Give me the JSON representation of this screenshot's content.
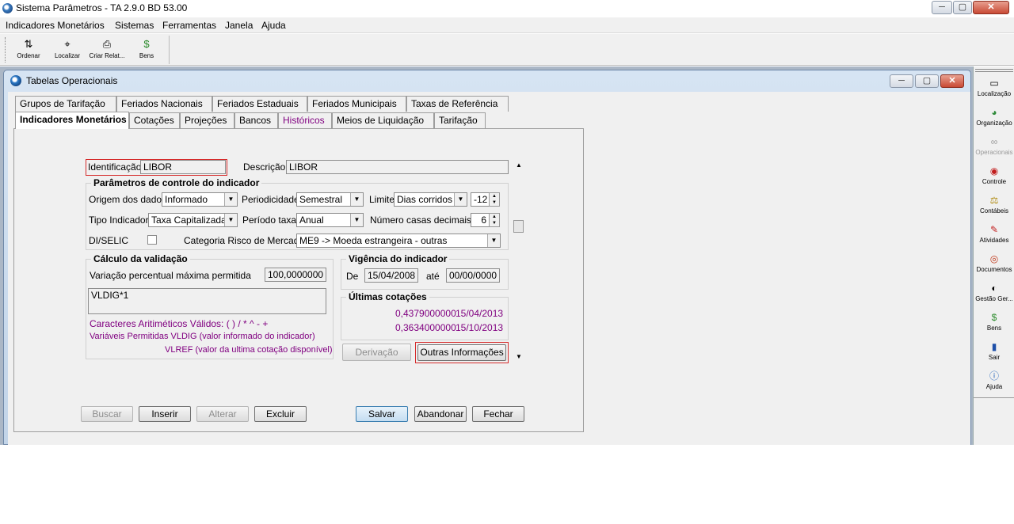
{
  "app": {
    "title": "Sistema Parâmetros -  TA 2.9.0 BD 53.00"
  },
  "window_controls": {
    "minimize": "─",
    "maximize": "▢",
    "close": "✕"
  },
  "menu": [
    "Indicadores Monetários",
    "Sistemas",
    "Ferramentas",
    "Janela",
    "Ajuda"
  ],
  "toolbar": [
    {
      "label": "Ordenar",
      "icon": "sort-icon"
    },
    {
      "label": "Localizar",
      "icon": "locate-icon"
    },
    {
      "label": "Criar Relat...",
      "icon": "printer-icon"
    },
    {
      "label": "Bens",
      "icon": "money-bag-icon"
    }
  ],
  "right_panel": [
    {
      "label": "Localização",
      "icon": "locate-icon"
    },
    {
      "label": "Organização",
      "icon": "organization-icon"
    },
    {
      "label": "Operacionais",
      "icon": "handshake-icon"
    },
    {
      "label": "Controle",
      "icon": "control-icon"
    },
    {
      "label": "Contábeis",
      "icon": "scale-icon"
    },
    {
      "label": "Atividades",
      "icon": "pen-icon"
    },
    {
      "label": "Documentos",
      "icon": "target-icon"
    },
    {
      "label": "Gestão Ger...",
      "icon": "eye-icon"
    },
    {
      "label": "Bens",
      "icon": "money-bag-icon"
    },
    {
      "label": "Sair",
      "icon": "exit-door-icon"
    },
    {
      "label": "Ajuda",
      "icon": "help-icon"
    }
  ],
  "child_window": {
    "title": "Tabelas Operacionais"
  },
  "tabs_row1": [
    "Grupos de Tarifação",
    "Feriados Nacionais",
    "Feriados Estaduais",
    "Feriados Municipais",
    "Taxas de Referência"
  ],
  "tabs_row2": [
    "Indicadores Monetários",
    "Cotações",
    "Projeções",
    "Bancos",
    "Históricos",
    "Meios de Liquidação",
    "Tarifação"
  ],
  "form": {
    "identificacao_label": "Identificação",
    "identificacao_value": "LIBOR",
    "descricao_label": "Descrição",
    "descricao_value": "LIBOR",
    "params_title": "Parâmetros de controle do indicador",
    "origem_label": "Origem dos dados",
    "origem_value": "Informado",
    "periodicidade_label": "Periodicidade",
    "periodicidade_value": "Semestral",
    "limite_label": "Limite",
    "limite_value": "Dias corridos",
    "limite_num": "-12",
    "tipo_label": "Tipo Indicador",
    "tipo_value": "Taxa Capitalizada",
    "periodo_label": "Período taxa",
    "periodo_value": "Anual",
    "casas_label": "Número casas decimais",
    "casas_value": "6",
    "diselic_label": "DI/SELIC",
    "categoria_label": "Categoria Risco de Mercado",
    "categoria_value": "ME9 -> Moeda estrangeira - outras",
    "calculo_title": "Cálculo da validação",
    "variacao_label": "Variação percentual máxima permitida",
    "variacao_value": "100,0000000",
    "formula_value": "VLDIG*1",
    "caracteres_text": "Caracteres Aritiméticos Válidos:    ( ) / * ^ - +",
    "variaveis_text": "Variáveis Permitidas VLDIG  (valor informado do indicador)",
    "vlref_text": "VLREF (valor da ultima cotação disponível)",
    "vigencia_title": "Vigência do indicador",
    "de_label": "De",
    "de_value": "15/04/2008",
    "ate_label": "até",
    "ate_value": "00/00/0000",
    "ultimas_title": "Últimas cotações",
    "cotacoes": [
      {
        "valor": "0,4379000000",
        "data": "15/04/2013"
      },
      {
        "valor": "0,3634000000",
        "data": "15/10/2013"
      }
    ],
    "derivacao_btn": "Derivação",
    "outras_btn": "Outras Informações"
  },
  "actions": {
    "buscar": "Buscar",
    "inserir": "Inserir",
    "alterar": "Alterar",
    "excluir": "Excluir",
    "salvar": "Salvar",
    "abandonar": "Abandonar",
    "fechar": "Fechar"
  },
  "colors": {
    "highlight_red": "#d52b2b",
    "arrow_red": "#e8321e",
    "purple_text": "#800080"
  }
}
